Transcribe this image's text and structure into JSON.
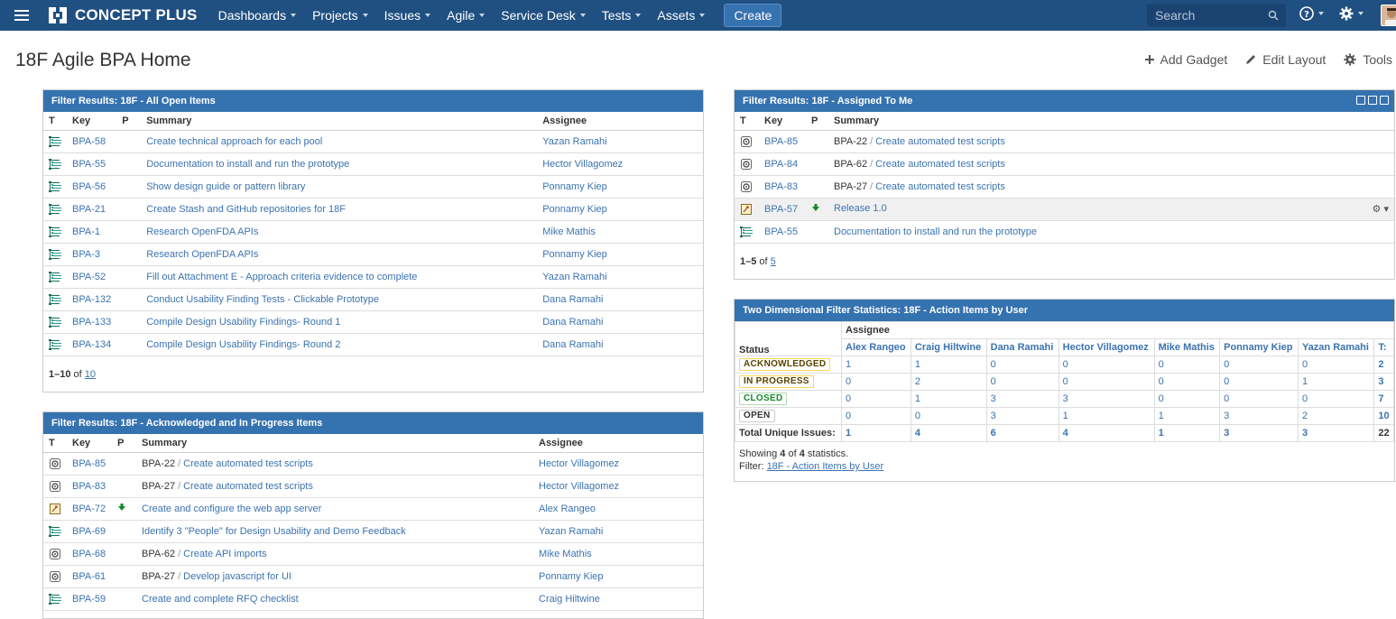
{
  "nav": {
    "brand": "CONCEPT PLUS",
    "items": [
      "Dashboards",
      "Projects",
      "Issues",
      "Agile",
      "Service Desk",
      "Tests",
      "Assets"
    ],
    "create_label": "Create",
    "search_placeholder": "Search",
    "accent": "#205081"
  },
  "page": {
    "title": "18F Agile BPA Home",
    "actions": [
      "Add Gadget",
      "Edit Layout",
      "Tools"
    ]
  },
  "gadget_open": {
    "title": "Filter Results: 18F - All Open Items",
    "columns": [
      "T",
      "Key",
      "P",
      "Summary",
      "Assignee"
    ],
    "rows": [
      {
        "key": "BPA-58",
        "summary": "Create technical approach for each pool",
        "assignee": "Yazan Ramahi"
      },
      {
        "key": "BPA-55",
        "summary": "Documentation to install and run the prototype",
        "assignee": "Hector Villagomez"
      },
      {
        "key": "BPA-56",
        "summary": "Show design guide or pattern library",
        "assignee": "Ponnamy Kiep"
      },
      {
        "key": "BPA-21",
        "summary": "Create Stash and GitHub repositories for 18F",
        "assignee": "Ponnamy Kiep"
      },
      {
        "key": "BPA-1",
        "summary": "Research OpenFDA APIs",
        "assignee": "Mike Mathis"
      },
      {
        "key": "BPA-3",
        "summary": "Research OpenFDA APIs",
        "assignee": "Ponnamy Kiep"
      },
      {
        "key": "BPA-52",
        "summary": "Fill out Attachment E - Approach criteria evidence to complete",
        "assignee": "Yazan Ramahi"
      },
      {
        "key": "BPA-132",
        "summary": "Conduct Usability Finding Tests - Clickable Prototype",
        "assignee": "Dana Ramahi"
      },
      {
        "key": "BPA-133",
        "summary": "Compile Design Usability Findings- Round 1",
        "assignee": "Dana Ramahi"
      },
      {
        "key": "BPA-134",
        "summary": "Compile Design Usability Findings- Round 2",
        "assignee": "Dana Ramahi"
      }
    ],
    "pager_range": "1–10",
    "pager_of": "of",
    "pager_total": "10"
  },
  "gadget_ack": {
    "title": "Filter Results: 18F - Acknowledged and In Progress Items",
    "columns": [
      "T",
      "Key",
      "P",
      "Summary",
      "Assignee"
    ],
    "rows": [
      {
        "type": "subtask",
        "key": "BPA-85",
        "parent": "BPA-22",
        "summary": "Create automated test scripts",
        "assignee": "Hector Villagomez"
      },
      {
        "type": "subtask",
        "key": "BPA-83",
        "parent": "BPA-27",
        "summary": "Create automated test scripts",
        "assignee": "Hector Villagomez"
      },
      {
        "type": "release",
        "key": "BPA-72",
        "priority": "low",
        "parent": "",
        "summary": "Create and configure the web app server",
        "assignee": "Alex Rangeo"
      },
      {
        "type": "story",
        "key": "BPA-69",
        "parent": "",
        "summary": "Identify 3 \"People\" for Design Usability and Demo Feedback",
        "assignee": "Yazan Ramahi"
      },
      {
        "type": "subtask",
        "key": "BPA-68",
        "parent": "BPA-62",
        "summary": "Create API imports",
        "assignee": "Mike Mathis"
      },
      {
        "type": "subtask",
        "key": "BPA-61",
        "parent": "BPA-27",
        "summary": "Develop javascript for UI",
        "assignee": "Ponnamy Kiep"
      },
      {
        "type": "story",
        "key": "BPA-59",
        "parent": "",
        "summary": "Create and complete RFQ checklist",
        "assignee": "Craig Hiltwine"
      }
    ]
  },
  "gadget_me": {
    "title": "Filter Results: 18F - Assigned To Me",
    "columns": [
      "T",
      "Key",
      "P",
      "Summary"
    ],
    "rows": [
      {
        "type": "subtask",
        "key": "BPA-85",
        "parent": "BPA-22",
        "summary": "Create automated test scripts"
      },
      {
        "type": "subtask",
        "key": "BPA-84",
        "parent": "BPA-62",
        "summary": "Create automated test scripts"
      },
      {
        "type": "subtask",
        "key": "BPA-83",
        "parent": "BPA-27",
        "summary": "Create automated test scripts"
      },
      {
        "type": "release",
        "key": "BPA-57",
        "priority": "low",
        "parent": "",
        "summary": "Release 1.0"
      },
      {
        "type": "story",
        "key": "BPA-55",
        "parent": "",
        "summary": "Documentation to install and run the prototype"
      }
    ],
    "pager_range": "1–5",
    "pager_of": "of",
    "pager_total": "5"
  },
  "gadget_2d": {
    "title": "Two Dimensional Filter Statistics: 18F - Action Items by User",
    "row_header": "Status",
    "col_group": "Assignee",
    "columns": [
      "Alex Rangeo",
      "Craig Hiltwine",
      "Dana Ramahi",
      "Hector Villagomez",
      "Mike Mathis",
      "Ponnamy Kiep",
      "Yazan Ramahi",
      "T:"
    ],
    "rows": [
      {
        "status": "ACKNOWLEDGED",
        "cls": "loz-ack",
        "values": [
          "1",
          "1",
          "0",
          "0",
          "0",
          "0",
          "0",
          "2"
        ]
      },
      {
        "status": "IN PROGRESS",
        "cls": "loz-prog",
        "values": [
          "0",
          "2",
          "0",
          "0",
          "0",
          "0",
          "1",
          "3"
        ]
      },
      {
        "status": "CLOSED",
        "cls": "loz-closed",
        "values": [
          "0",
          "1",
          "3",
          "3",
          "0",
          "0",
          "0",
          "7"
        ]
      },
      {
        "status": "OPEN",
        "cls": "loz-open",
        "values": [
          "0",
          "0",
          "3",
          "1",
          "1",
          "3",
          "2",
          "10"
        ]
      }
    ],
    "total_label": "Total Unique Issues:",
    "totals": [
      "1",
      "4",
      "6",
      "4",
      "1",
      "3",
      "3",
      "22"
    ],
    "showing_prefix": "Showing",
    "showing_count": "4",
    "showing_of": "of",
    "showing_total": "4",
    "showing_suffix": "statistics.",
    "filter_label": "Filter:",
    "filter_link": "18F - Action Items by User"
  }
}
